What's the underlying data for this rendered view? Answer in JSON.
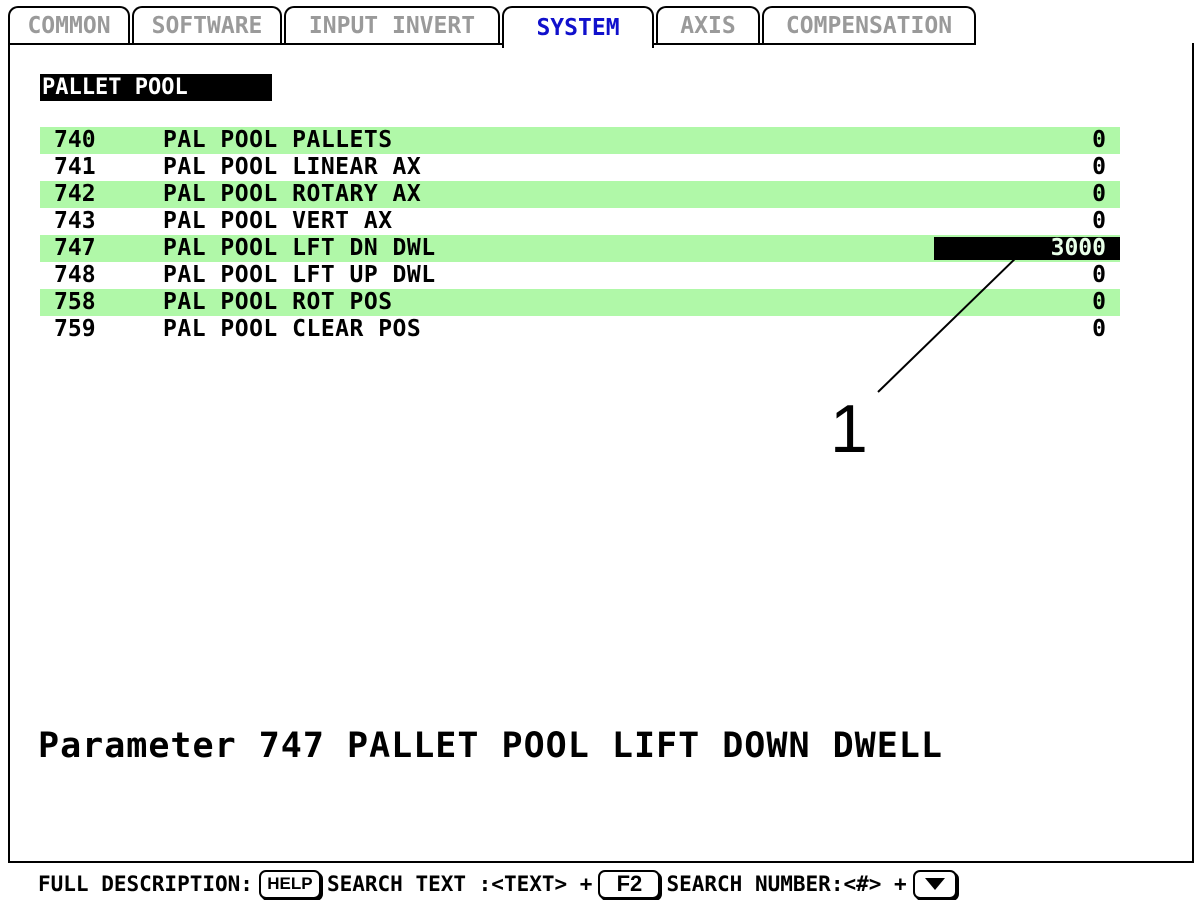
{
  "tabs": [
    {
      "label": "COMMON",
      "active": false
    },
    {
      "label": "SOFTWARE",
      "active": false
    },
    {
      "label": "INPUT INVERT",
      "active": false
    },
    {
      "label": "SYSTEM",
      "active": true
    },
    {
      "label": "AXIS",
      "active": false
    },
    {
      "label": "COMPENSATION",
      "active": false
    }
  ],
  "group_title": "PALLET POOL",
  "parameters": [
    {
      "number": "740",
      "name": "PAL POOL PALLETS",
      "value": "0"
    },
    {
      "number": "741",
      "name": "PAL POOL LINEAR AX",
      "value": "0"
    },
    {
      "number": "742",
      "name": "PAL POOL ROTARY AX",
      "value": "0"
    },
    {
      "number": "743",
      "name": "PAL POOL VERT AX",
      "value": "0"
    },
    {
      "number": "747",
      "name": "PAL POOL LFT DN DWL",
      "value": "3000"
    },
    {
      "number": "748",
      "name": "PAL POOL LFT UP DWL",
      "value": "0"
    },
    {
      "number": "758",
      "name": "PAL POOL ROT POS",
      "value": "0"
    },
    {
      "number": "759",
      "name": "PAL POOL CLEAR POS",
      "value": "0"
    }
  ],
  "selected_parameter": "747",
  "callout_label": "1",
  "description": "Parameter 747 PALLET POOL LIFT DOWN DWELL",
  "footer": {
    "full_description_label": "FULL DESCRIPTION:",
    "help_key": "HELP",
    "search_text_label": "SEARCH TEXT :<TEXT> +",
    "f2_key": "F2",
    "search_number_label": "SEARCH NUMBER:<#> +",
    "arrow_key_icon": "down-arrow-icon"
  },
  "colors": {
    "row_shade": "#b0f8a8",
    "active_tab": "#1010cc",
    "inactive_tab": "#9a9a9a",
    "selection_bg": "#000000"
  }
}
